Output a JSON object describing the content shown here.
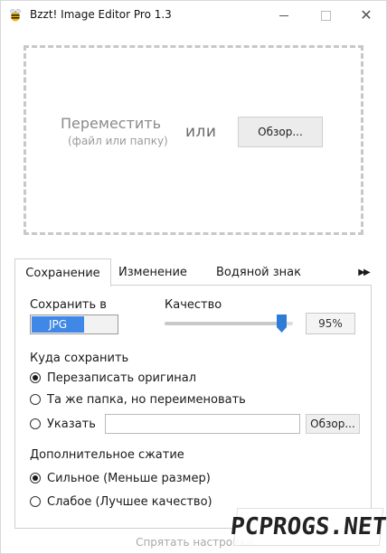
{
  "window": {
    "title": "Bzzt! Image Editor Pro 1.3",
    "close_glyph": "✕"
  },
  "drop_zone": {
    "move_text": "Переместить",
    "sub_text": "(файл или папку)",
    "or_text": "или",
    "browse_label": "Обзор..."
  },
  "tabs": [
    {
      "label": "Сохранение",
      "active": true
    },
    {
      "label": "Изменение",
      "active": false
    },
    {
      "label": "Водяной знак",
      "active": false
    }
  ],
  "tab_more_glyph": "▶▶",
  "save_panel": {
    "save_in_label": "Сохранить в",
    "format_value": "JPG",
    "quality_label": "Качество",
    "quality_percent": 95,
    "quality_display": "95%",
    "where_label": "Куда сохранить",
    "where_options": [
      {
        "label": "Перезаписать оригинал",
        "checked": true
      },
      {
        "label": "Та же папка, но переименовать",
        "checked": false
      },
      {
        "label": "Указать",
        "checked": false
      }
    ],
    "path_value": "",
    "path_browse_label": "Обзор...",
    "compression_label": "Дополнительное сжатие",
    "compression_options": [
      {
        "label": "Сильное (Меньше размер)",
        "checked": true
      },
      {
        "label": "Слабое (Лучшее качество)",
        "checked": false
      }
    ]
  },
  "footer": {
    "hide_settings_label": "Спрятать настройки"
  },
  "watermark_text": "PCPROGS.NET",
  "colors": {
    "accent": "#3f88e8",
    "slider_thumb": "#2d7cd6"
  }
}
